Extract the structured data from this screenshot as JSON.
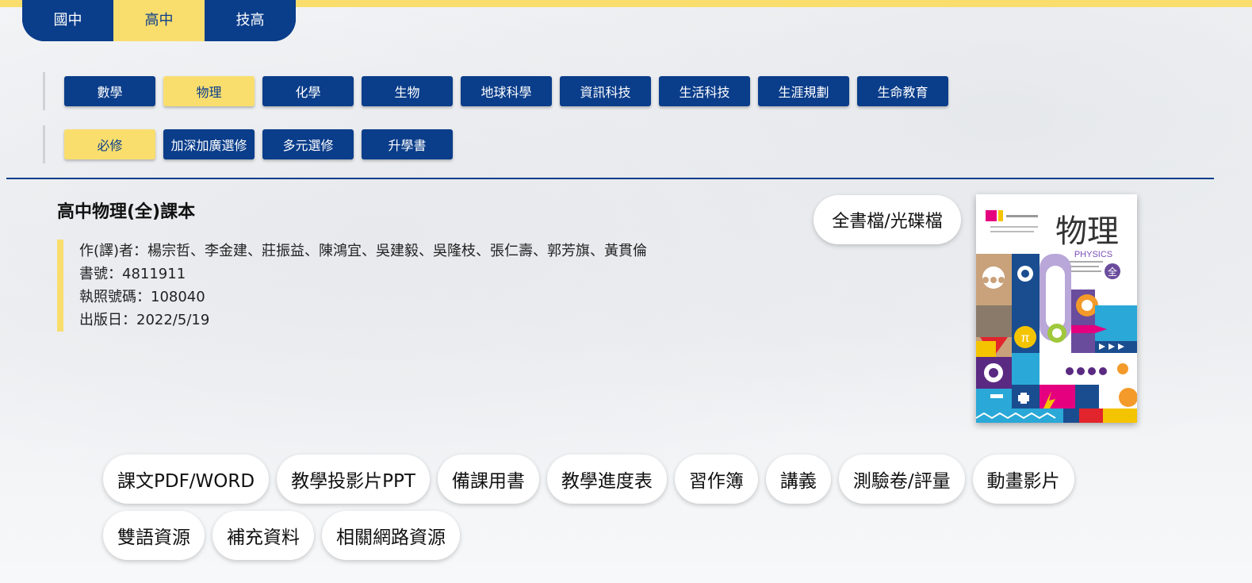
{
  "levels": [
    {
      "label": "國中",
      "active": false
    },
    {
      "label": "高中",
      "active": true
    },
    {
      "label": "技高",
      "active": false
    }
  ],
  "subjects": [
    "數學",
    "物理",
    "化學",
    "生物",
    "地球科學",
    "資訊科技",
    "生活科技",
    "生涯規劃",
    "生命教育"
  ],
  "subject_active": "物理",
  "course_types": [
    "必修",
    "加深加廣選修",
    "多元選修",
    "升學書"
  ],
  "course_type_active": "必修",
  "book": {
    "title": "高中物理(全)課本",
    "authors": "作(譯)者：楊宗哲、李金建、莊振益、陳鴻宜、吳建毅、吳隆枝、張仁壽、郭芳旗、黃貫倫",
    "book_no": "書號：4811911",
    "license_no": "執照號碼：108040",
    "publish_date": "出版日：2022/5/19",
    "fullbook_label": "全書檔/光碟檔",
    "cover": {
      "title": "物理",
      "subtitle": "PHYSICS",
      "badge": "全"
    }
  },
  "resources_row1": [
    "課文PDF/WORD",
    "教學投影片PPT",
    "備課用書",
    "教學進度表",
    "習作簿",
    "講義",
    "測驗卷/評量",
    "動畫影片"
  ],
  "resources_row2": [
    "雙語資源",
    "補充資料",
    "相關網路資源"
  ],
  "colors": {
    "navy": "#0a3d8a",
    "yellow": "#f9de6e"
  }
}
